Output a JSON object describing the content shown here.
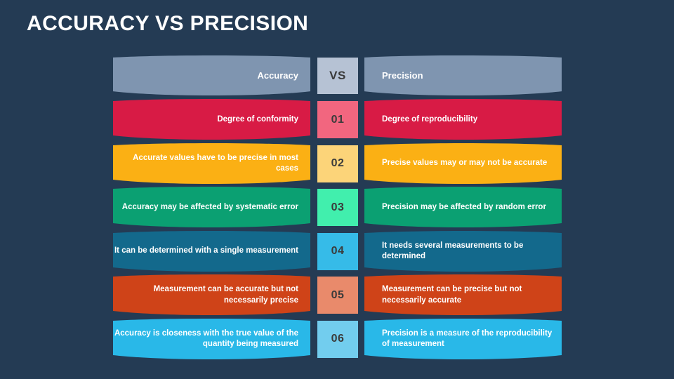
{
  "slide": {
    "title": "ACCURACY VS PRECISION",
    "background_color": "#243b54"
  },
  "header": {
    "left_label": "Accuracy",
    "center_label": "VS",
    "right_label": "Precision",
    "bar_color": "#7f95b0",
    "center_color": "#b6c2d4"
  },
  "rows": [
    {
      "number": "01",
      "left": "Degree of conformity",
      "right": "Degree of reproducibility",
      "bar_color": "#d81b45",
      "number_color": "#f2667f"
    },
    {
      "number": "02",
      "left": "Accurate values have to be precise in most cases",
      "right": "Precise values may or may not be accurate",
      "bar_color": "#fbb014",
      "number_color": "#fcd479"
    },
    {
      "number": "03",
      "left": "Accuracy may be affected by systematic error",
      "right": "Precision may be affected by random error",
      "bar_color": "#0ba072",
      "number_color": "#41efad"
    },
    {
      "number": "04",
      "left": "It can be determined with a single measurement",
      "right": "It needs several measurements to be determined",
      "bar_color": "#13698c",
      "number_color": "#36bbe8"
    },
    {
      "number": "05",
      "left": "Measurement can be accurate but not necessarily precise",
      "right": "Measurement can be precise but not necessarily accurate",
      "bar_color": "#cf4318",
      "number_color": "#e98a6b"
    },
    {
      "number": "06",
      "left": "Accuracy is closeness with the true value of the quantity being measured",
      "right": "Precision is a measure of the reproducibility of measurement",
      "bar_color": "#29b8e8",
      "number_color": "#72cdee"
    }
  ]
}
